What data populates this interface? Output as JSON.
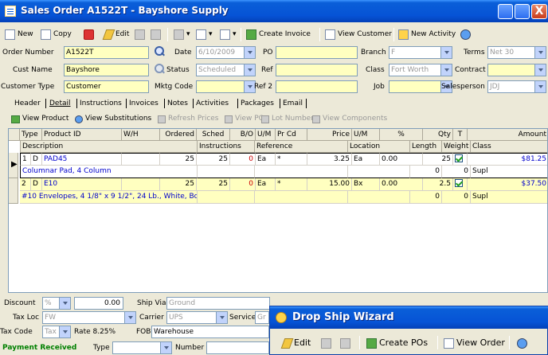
{
  "window": {
    "title": "Sales Order A1522T - Bayshore Supply",
    "close_glyph": "X"
  },
  "toolbar": {
    "new_label": "New",
    "copy_label": "Copy",
    "edit_label": "Edit",
    "create_invoice_label": "Create Invoice",
    "view_customer_label": "View Customer",
    "new_activity_label": "New Activity"
  },
  "header": {
    "order_number_label": "Order Number",
    "order_number": "A1522T",
    "date_label": "Date",
    "date": "6/10/2009",
    "po_label": "PO",
    "po": "",
    "branch_label": "Branch",
    "branch": "F",
    "terms_label": "Terms",
    "terms": "Net 30",
    "cust_name_label": "Cust Name",
    "cust_name": "Bayshore",
    "status_label": "Status",
    "status": "Scheduled",
    "ref_label": "Ref",
    "ref": "",
    "class_label": "Class",
    "class_value": "Fort Worth",
    "contract_label": "Contract",
    "contract": "",
    "customer_type_label": "Customer Type",
    "customer_type": "Customer",
    "mktg_code_label": "Mktg Code",
    "mktg_code": "",
    "ref2_label": "Ref 2",
    "ref2": "",
    "job_label": "Job",
    "job": "",
    "salesperson_label": "Salesperson",
    "salesperson": "JDJ"
  },
  "tabs": [
    "Header",
    "Detail",
    "Instructions",
    "Invoices",
    "Notes",
    "Activities",
    "Packages",
    "Email"
  ],
  "subbar": {
    "view_product": "View Product",
    "view_substitutions": "View Substitutions",
    "refresh_prices": "Refresh Prices",
    "view_po": "View PO",
    "lot_numbers": "Lot Numbers",
    "view_components": "View Components"
  },
  "grid": {
    "header_row1": [
      "",
      "Type",
      "Product ID",
      "W/H",
      "Ordered",
      "Sched",
      "B/O",
      "U/M",
      "Pr Cd",
      "Price",
      "U/M",
      "%",
      "Qty",
      "T",
      "Amount"
    ],
    "header_row2": [
      "Description",
      "Instructions",
      "Reference",
      "Location",
      "Length",
      "Weight",
      "Class"
    ],
    "lines": [
      {
        "num": "1",
        "type": "D",
        "product": "PAD45",
        "wh": "",
        "ordered": "25",
        "sched": "25",
        "bo": "0",
        "um": "Ea",
        "prcd": "*",
        "price": "3.25",
        "pum": "Ea",
        "pct": "0.00",
        "qty": "25",
        "amount": "$81.25",
        "description": "Columnar Pad, 4 Column",
        "instructions": "",
        "reference": "",
        "location": "",
        "length": "0",
        "weight": "0",
        "class": "Supl"
      },
      {
        "num": "2",
        "type": "D",
        "product": "E10",
        "wh": "",
        "ordered": "25",
        "sched": "25",
        "bo": "0",
        "um": "Ea",
        "prcd": "*",
        "price": "15.00",
        "pum": "Bx",
        "pct": "0.00",
        "qty": "2.5",
        "amount": "$37.50",
        "description": "#10 Envelopes, 4 1/8\" x 9 1/2\", 24 Lb., White, Box",
        "instructions": "",
        "reference": "",
        "location": "",
        "length": "0",
        "weight": "0",
        "class": "Supl"
      }
    ]
  },
  "footer": {
    "discount_label": "Discount",
    "discount_pct": "%",
    "discount_value": "0.00",
    "ship_via_label": "Ship Via",
    "ship_via": "Ground",
    "tax_loc_label": "Tax Loc",
    "tax_loc": "FW",
    "carrier_label": "Carrier",
    "carrier": "UPS",
    "service_label": "Service",
    "service": "Gr",
    "tax_code_label": "Tax Code",
    "tax_code": "Tax",
    "rate_text": "Rate 8.25%",
    "fob_label": "FOB",
    "fob": "Warehouse",
    "payment_received": "Payment Received",
    "type_label": "Type",
    "number_label": "Number"
  },
  "drop_ship": {
    "title": "Drop Ship Wizard",
    "edit_label": "Edit",
    "create_pos_label": "Create POs",
    "view_order_label": "View Order"
  },
  "colors": {
    "title_blue": "#0653d6",
    "field_yellow": "#ffffc0",
    "link_blue": "#0000cc",
    "bo_red": "#cc0000",
    "payment_green": "#008000"
  }
}
